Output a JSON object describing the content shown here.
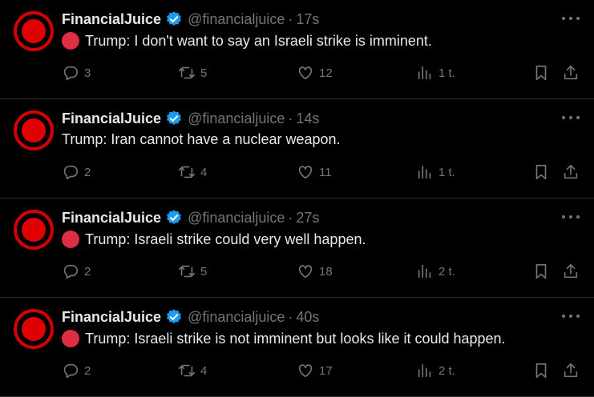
{
  "tweets": [
    {
      "author": "FinancialJuice",
      "handle": "@financialjuice",
      "time": "17s",
      "has_dot": true,
      "text": "Trump: I don't want to say an Israeli strike is imminent.",
      "replies": "3",
      "retweets": "5",
      "likes": "12",
      "views": "1 t."
    },
    {
      "author": "FinancialJuice",
      "handle": "@financialjuice",
      "time": "14s",
      "has_dot": false,
      "text": "Trump: Iran cannot have a nuclear weapon.",
      "replies": "2",
      "retweets": "4",
      "likes": "11",
      "views": "1 t."
    },
    {
      "author": "FinancialJuice",
      "handle": "@financialjuice",
      "time": "27s",
      "has_dot": true,
      "text": "Trump: Israeli strike could very well happen.",
      "replies": "2",
      "retweets": "5",
      "likes": "18",
      "views": "2 t."
    },
    {
      "author": "FinancialJuice",
      "handle": "@financialjuice",
      "time": "40s",
      "has_dot": true,
      "text": "Trump: Israeli strike is not imminent but looks like it could happen.",
      "replies": "2",
      "retweets": "4",
      "likes": "17",
      "views": "2 t."
    }
  ],
  "separator": "·",
  "colors": {
    "background": "#000000",
    "text": "#e7e9ea",
    "muted": "#71767b",
    "verified": "#1d9bf0",
    "avatar_red": "#e00000",
    "emoji_red_circle": "#dd2e44"
  },
  "icons": [
    "verified-badge-icon",
    "more-icon",
    "reply-icon",
    "retweet-icon",
    "like-icon",
    "views-icon",
    "bookmark-icon",
    "share-icon"
  ]
}
